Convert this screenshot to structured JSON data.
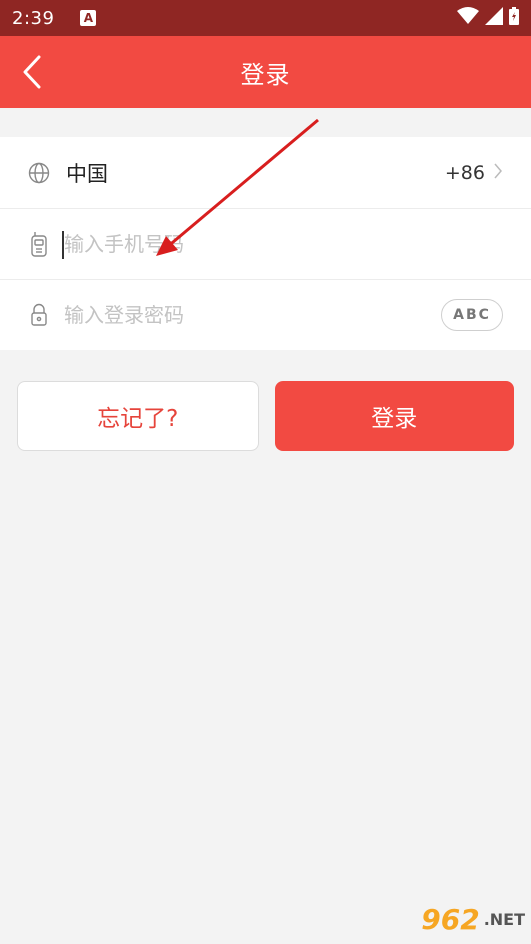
{
  "status_bar": {
    "time": "2:39",
    "notification_badge": "A"
  },
  "app_bar": {
    "title": "登录"
  },
  "form": {
    "country": {
      "name": "中国",
      "code": "+86"
    },
    "phone": {
      "value": "",
      "placeholder": "输入手机号码"
    },
    "password": {
      "value": "",
      "placeholder": "输入登录密码",
      "toggle_label": "ABC"
    }
  },
  "buttons": {
    "forgot": "忘记了?",
    "login": "登录"
  },
  "watermark": {
    "logo": "962",
    "suffix": ".NET"
  },
  "colors": {
    "status_bar": "#8f2623",
    "accent": "#f24a42",
    "background": "#f3f3f3"
  }
}
